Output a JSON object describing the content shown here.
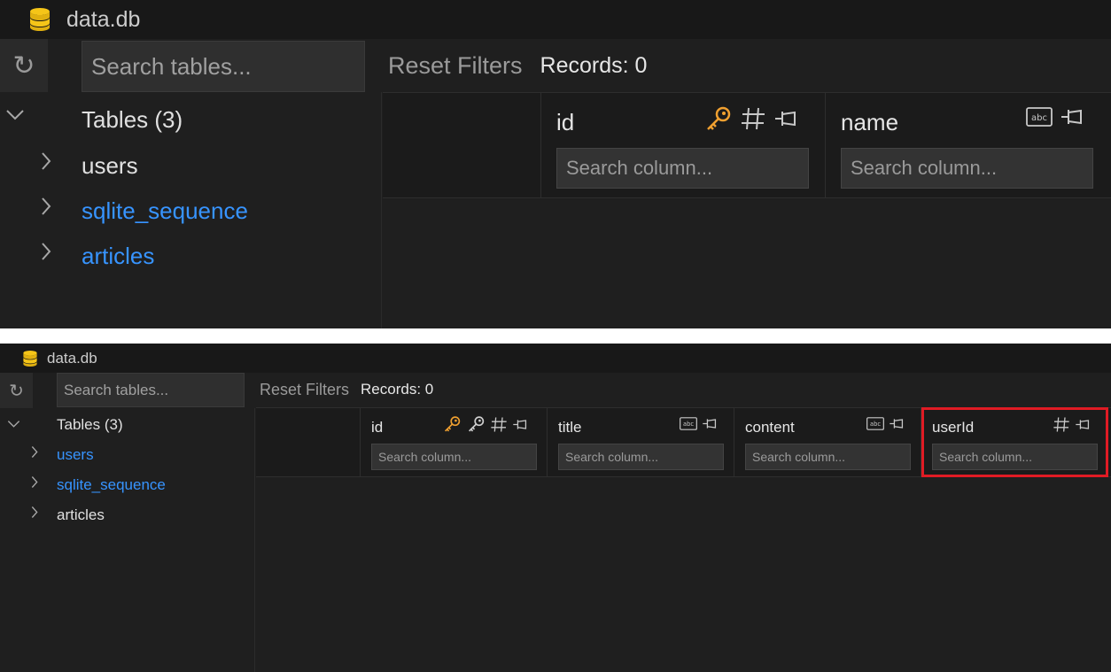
{
  "top": {
    "app_title": "data.db",
    "search_tables_placeholder": "Search tables...",
    "tree": {
      "group_label": "Tables (3)",
      "items": [
        {
          "label": "users"
        },
        {
          "label": "sqlite_sequence"
        },
        {
          "label": "articles"
        }
      ]
    },
    "toolbar": {
      "reset_label": "Reset Filters",
      "records_label": "Records: 0"
    },
    "columns": [
      {
        "name": "id",
        "icons": [
          "key-icon",
          "hash-icon",
          "pin-icon"
        ],
        "search_placeholder": "Search column..."
      },
      {
        "name": "name",
        "icons": [
          "text-type-icon",
          "pin-icon"
        ],
        "search_placeholder": "Search column..."
      }
    ]
  },
  "bottom": {
    "app_title": "data.db",
    "search_tables_placeholder": "Search tables...",
    "tree": {
      "group_label": "Tables (3)",
      "items": [
        {
          "label": "users"
        },
        {
          "label": "sqlite_sequence"
        },
        {
          "label": "articles"
        }
      ]
    },
    "toolbar": {
      "reset_label": "Reset Filters",
      "records_label": "Records: 0"
    },
    "columns": [
      {
        "name": "id",
        "icons": [
          "key-icon",
          "foreign-key-icon",
          "hash-icon",
          "pin-icon"
        ],
        "search_placeholder": "Search column..."
      },
      {
        "name": "title",
        "icons": [
          "text-type-icon",
          "pin-icon"
        ],
        "search_placeholder": "Search column..."
      },
      {
        "name": "content",
        "icons": [
          "text-type-icon",
          "pin-icon"
        ],
        "search_placeholder": "Search column..."
      },
      {
        "name": "userId",
        "icons": [
          "hash-icon",
          "pin-icon"
        ],
        "search_placeholder": "Search column..."
      }
    ]
  },
  "colors": {
    "background": "#1f1f1f",
    "link": "#3794ff",
    "key_orange": "#f0a030",
    "db_icon_yellow": "#f5c518",
    "highlight_red": "#e01b24"
  }
}
